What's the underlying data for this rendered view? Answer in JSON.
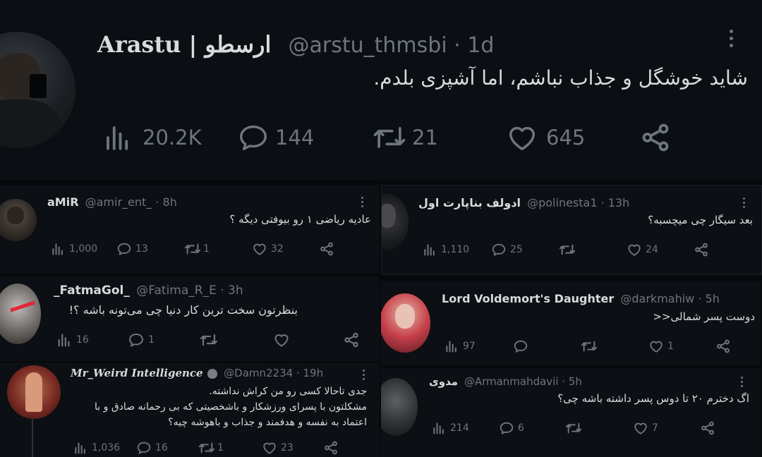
{
  "main": {
    "name": "Arastu | ارسطو",
    "handle": "@arstu_thmsbi · 1d",
    "text": "شاید خوشگل و جذاب نباشم، اما آشپزی بلدم.",
    "views": "20.2K",
    "replies": "144",
    "retweets": "21",
    "likes": "645"
  },
  "replies": [
    {
      "name": "aMiR",
      "handle": "@amir_ent_ · 8h",
      "text": "عادیه ریاضی ۱ رو بیوفتی دیگه ؟",
      "views": "1,000",
      "replies": "13",
      "retweets": "1",
      "likes": "32"
    },
    {
      "name": "ادولف بناپارت اول",
      "handle": "@polinesta1 · 13h",
      "text": "بعد سیگار چی میچسبه؟",
      "views": "1,110",
      "replies": "25",
      "retweets": "",
      "likes": "24"
    },
    {
      "name": "_FatmaGol_",
      "handle": "@Fatima_R_E · 3h",
      "text": "بنظرتون سخت ترین کار دنیا چی می‌تونه باشه ؟!",
      "views": "16",
      "replies": "1",
      "retweets": "",
      "likes": ""
    },
    {
      "name": "Lord Voldemort's Daughter",
      "handle": "@darkmahiw · 5h",
      "text": "دوست پسر شمالی<<",
      "views": "97",
      "replies": "",
      "retweets": "",
      "likes": "1"
    },
    {
      "name": "Mr_Weird Intelligence",
      "handle": "@Damn2234 · 19h",
      "text": [
        "جدی تاحالا کسی رو من کراش نداشته.",
        "مشکلتون با پسرای ورزشکار و باشخصیتی که بی رحمانه صادق و با",
        "اعتماد به نفسه و هدفمند و جذاب و باهوشه چیه؟"
      ],
      "views": "1,036",
      "replies": "16",
      "retweets": "1",
      "likes": "23"
    },
    {
      "name": "مدوی",
      "handle": "@Armanmahdavii · 5h",
      "text": "اگ دخترم ۲۰ تا دوس پسر داشته باشه چی؟",
      "views": "214",
      "replies": "6",
      "retweets": "",
      "likes": "7"
    }
  ],
  "icons": {
    "views": "bar-chart-icon",
    "reply": "comment-icon",
    "retweet": "retweet-icon",
    "like": "heart-icon",
    "share": "share-icon",
    "more": "more-icon"
  },
  "colors": {
    "background": "#06080b",
    "panel": "#0c0f13",
    "muted": "#6e767d",
    "text": "#d9dbdd"
  }
}
